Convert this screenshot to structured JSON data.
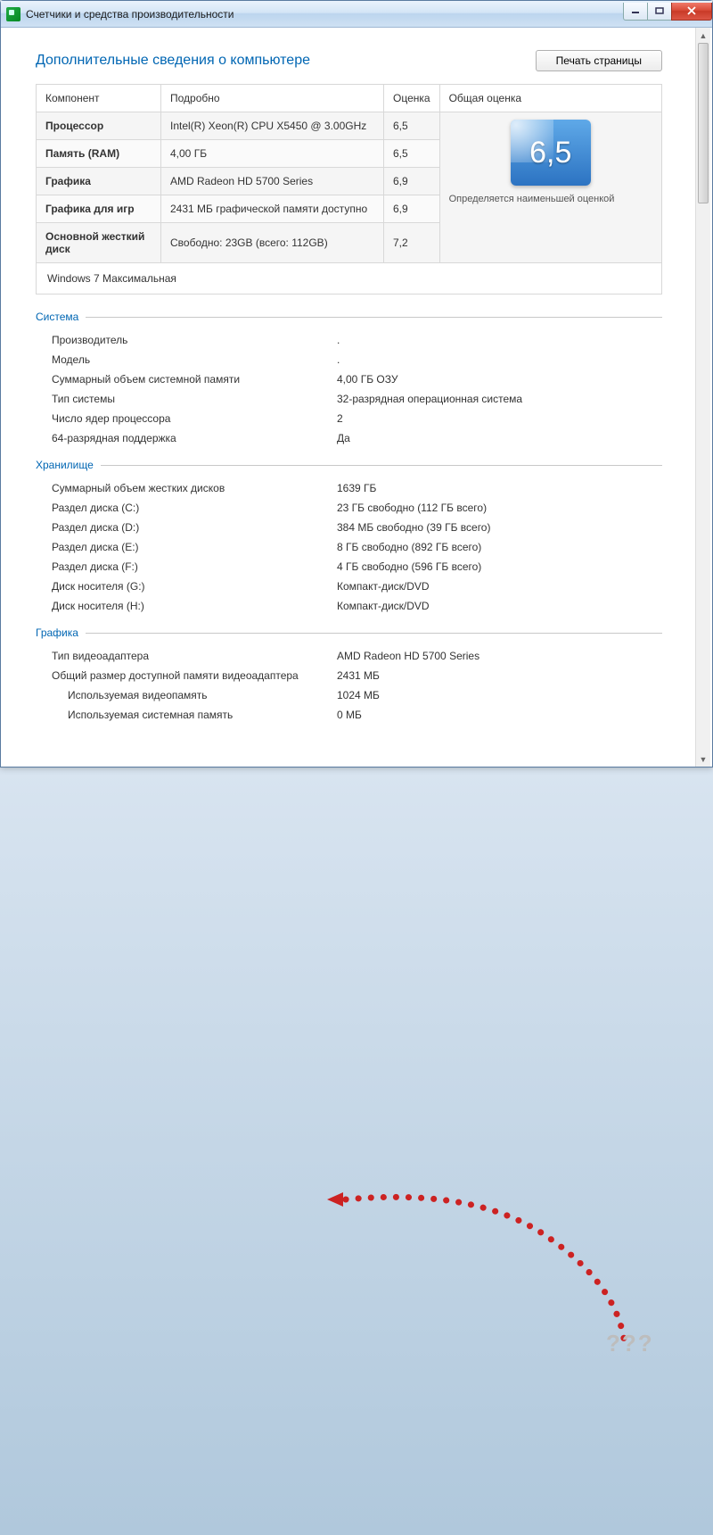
{
  "window": {
    "title": "Счетчики и средства производительности"
  },
  "header": {
    "page_title": "Дополнительные сведения о компьютере",
    "print_button": "Печать страницы"
  },
  "assess": {
    "columns": {
      "component": "Компонент",
      "details": "Подробно",
      "score": "Оценка",
      "overall": "Общая оценка"
    },
    "rows": [
      {
        "label": "Процессор",
        "detail": "Intel(R) Xeon(R) CPU X5450 @ 3.00GHz",
        "score": "6,5"
      },
      {
        "label": "Память (RAM)",
        "detail": "4,00 ГБ",
        "score": "6,5"
      },
      {
        "label": "Графика",
        "detail": "AMD Radeon HD 5700 Series",
        "score": "6,9"
      },
      {
        "label": "Графика для игр",
        "detail": "2431 МБ графической памяти доступно",
        "score": "6,9"
      },
      {
        "label": "Основной жесткий диск",
        "detail": "Свободно: 23GB (всего: 112GB)",
        "score": "7,2"
      }
    ],
    "overall_score": "6,5",
    "overall_caption": "Определяется наименьшей оценкой",
    "os": "Windows 7 Максимальная"
  },
  "sections": {
    "system": {
      "title": "Система",
      "items": [
        {
          "k": "Производитель",
          "v": "."
        },
        {
          "k": "Модель",
          "v": "."
        },
        {
          "k": "Суммарный объем системной памяти",
          "v": "4,00 ГБ ОЗУ"
        },
        {
          "k": "Тип системы",
          "v": "32-разрядная операционная система"
        },
        {
          "k": "Число ядер процессора",
          "v": "2"
        },
        {
          "k": "64-разрядная поддержка",
          "v": "Да"
        }
      ]
    },
    "storage": {
      "title": "Хранилище",
      "items": [
        {
          "k": "Суммарный объем жестких дисков",
          "v": "1639 ГБ"
        },
        {
          "k": "Раздел диска (C:)",
          "v": "23 ГБ свободно (112 ГБ всего)"
        },
        {
          "k": "Раздел диска (D:)",
          "v": "384 МБ свободно (39 ГБ всего)"
        },
        {
          "k": "Раздел диска (E:)",
          "v": "8 ГБ свободно (892 ГБ всего)"
        },
        {
          "k": "Раздел диска (F:)",
          "v": "4 ГБ свободно (596 ГБ всего)"
        },
        {
          "k": "Диск носителя (G:)",
          "v": "Компакт-диск/DVD"
        },
        {
          "k": "Диск носителя (H:)",
          "v": "Компакт-диск/DVD"
        }
      ]
    },
    "graphics": {
      "title": "Графика",
      "items": [
        {
          "k": "Тип видеоадаптера",
          "v": "AMD Radeon HD 5700 Series"
        },
        {
          "k": "Общий размер доступной памяти видеоадаптера",
          "v": "2431 МБ"
        },
        {
          "k": "Используемая видеопамять",
          "v": "1024 МБ",
          "indent": true
        },
        {
          "k": "Используемая системная память",
          "v": "0 МБ",
          "indent": true
        }
      ]
    }
  },
  "annotation": {
    "question_marks": "???"
  }
}
